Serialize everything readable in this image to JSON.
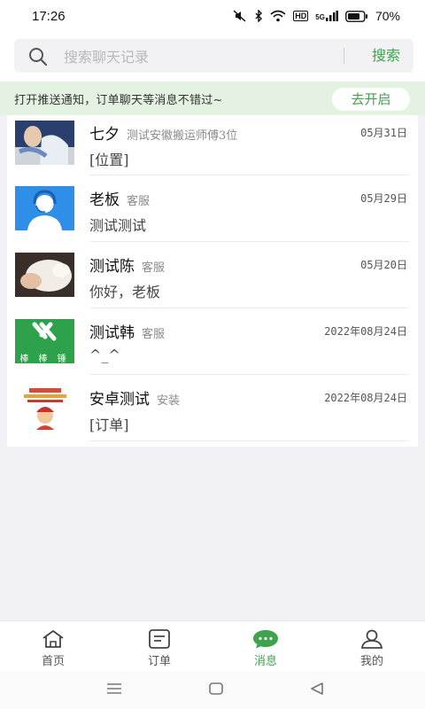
{
  "status_bar": {
    "time": "17:26",
    "network_label": "HD",
    "signal_label": "5G",
    "battery": "70%"
  },
  "search": {
    "placeholder": "搜索聊天记录",
    "button": "搜索"
  },
  "notice": {
    "text": "打开推送通知，订单聊天等消息不错过~",
    "button": "去开启"
  },
  "conversations": [
    {
      "name": "七夕",
      "tag": "测试安徽搬运师傅3位",
      "time": "05月31日",
      "message": "[位置]"
    },
    {
      "name": "老板",
      "tag": "客服",
      "time": "05月29日",
      "message": "测试测试"
    },
    {
      "name": "测试陈",
      "tag": "客服",
      "time": "05月20日",
      "message": "你好，老板"
    },
    {
      "name": "测试韩",
      "tag": "客服",
      "time": "2022年08月24日",
      "message": "^_^"
    },
    {
      "name": "安卓测试",
      "tag": "安装",
      "time": "2022年08月24日",
      "message": "[订单]"
    }
  ],
  "avatar_logo_text": "棒 棒 锤",
  "nav": [
    {
      "label": "首页",
      "icon": "home-icon"
    },
    {
      "label": "订单",
      "icon": "order-icon"
    },
    {
      "label": "消息",
      "icon": "chat-icon"
    },
    {
      "label": "我的",
      "icon": "profile-icon"
    }
  ],
  "colors": {
    "accent": "#3fa34d",
    "notice_bg": "#e4f3e1",
    "page_bg": "#f2f2f6"
  }
}
